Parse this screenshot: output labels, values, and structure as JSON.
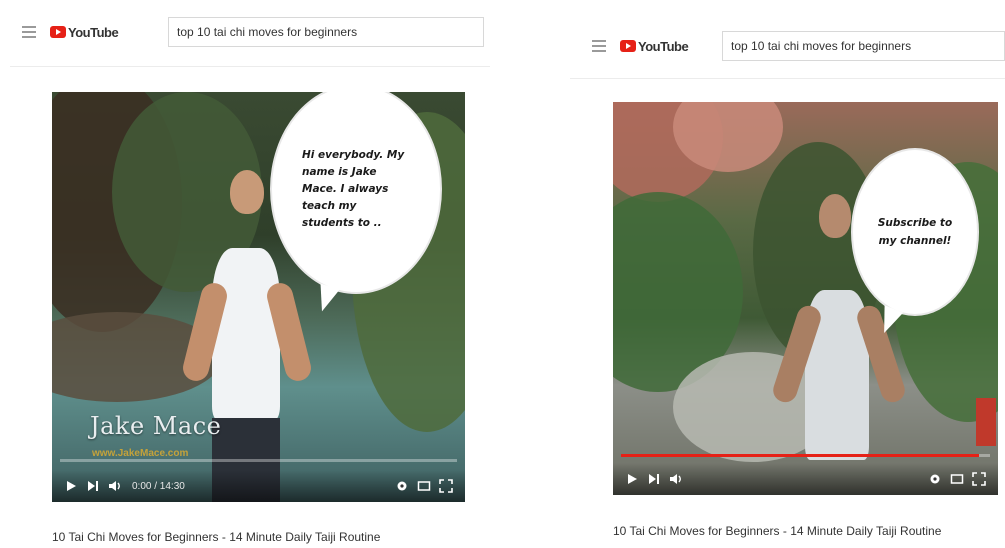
{
  "panels": [
    {
      "logo_text": "YouTube",
      "search_query": "top 10 tai chi moves for beginners",
      "speech_bubble": "Hi everybody. My name is Jake Mace. I always teach my students to ..",
      "watermark_name": "Jake Mace",
      "watermark_url": "www.JakeMace.com",
      "time_display": "0:00 / 14:30",
      "progress": 0.0,
      "video_title": "10 Tai Chi Moves for Beginners - 14 Minute Daily Taiji Routine"
    },
    {
      "logo_text": "YouTube",
      "search_query": "top 10 tai chi moves for beginners",
      "speech_bubble": "Subscribe to my channel!",
      "time_display": "",
      "progress": 0.97,
      "video_title": "10 Tai Chi Moves for Beginners - 14 Minute Daily Taiji Routine"
    }
  ],
  "colors": {
    "accent": "#e62117",
    "watermark_url": "#c4a23a"
  },
  "icons": [
    "menu-icon",
    "youtube-logo-icon",
    "play-icon",
    "next-icon",
    "volume-icon",
    "settings-icon",
    "miniplayer-icon",
    "fullscreen-icon"
  ]
}
